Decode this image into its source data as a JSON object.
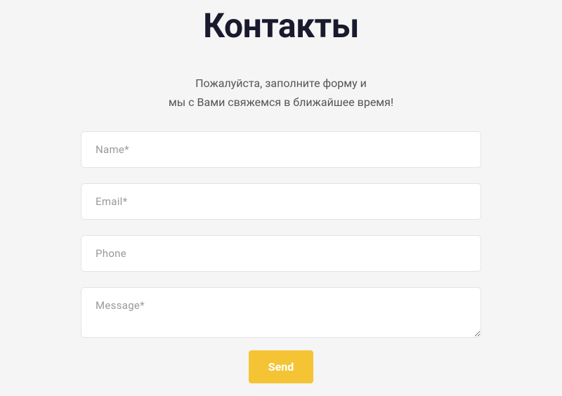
{
  "heading": "Контакты",
  "subtitle": {
    "line1": "Пожалуйста, заполните форму и",
    "line2": "мы с Вами свяжемся в ближайшее время!"
  },
  "form": {
    "name": {
      "placeholder": "Name*",
      "value": ""
    },
    "email": {
      "placeholder": "Email*",
      "value": ""
    },
    "phone": {
      "placeholder": "Phone",
      "value": ""
    },
    "message": {
      "placeholder": "Message*",
      "value": ""
    },
    "submit_label": "Send"
  }
}
